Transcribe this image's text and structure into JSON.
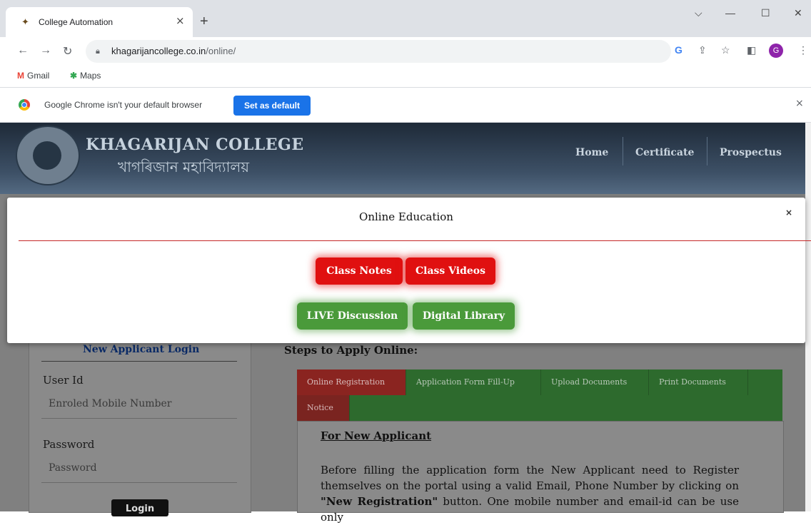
{
  "browser": {
    "tab_title": "College Automation",
    "tab_close": "×",
    "new_tab": "+",
    "window_controls": {
      "menu": "⌵",
      "minimize": "—",
      "maximize": "☐",
      "close": "✕"
    },
    "url_host": "khagarijancollege.co.in",
    "url_path": "/online/",
    "nav": {
      "back": "←",
      "forward": "→",
      "reload": "↻"
    },
    "toolbar_icons": {
      "google": "G",
      "share": "⇪",
      "star": "☆",
      "sidepanel": "◧"
    },
    "profile_initial": "G",
    "bookmarks": [
      {
        "icon": "M",
        "label": "Gmail"
      },
      {
        "icon": "✱",
        "label": "Maps"
      }
    ],
    "infobar": {
      "message": "Google Chrome isn't your default browser",
      "button": "Set as default",
      "close": "×"
    }
  },
  "site": {
    "title_en": "KHAGARIJAN COLLEGE",
    "title_bn": "খাগৰিজান মহাবিদ্যালয়",
    "nav": [
      "Home",
      "Certificate",
      "Prospectus"
    ]
  },
  "login_panel": {
    "title": "New Applicant Login",
    "userid_label": "User Id",
    "userid_placeholder": "Enroled Mobile Number",
    "password_label": "Password",
    "password_placeholder": "Password",
    "login_button": "Login"
  },
  "steps": {
    "title": "Steps to Apply Online:",
    "tabs": [
      "Online Registration",
      "Application Form Fill-Up",
      "Upload Documents",
      "Print Documents",
      "Notice"
    ],
    "active_tab": "Online Registration",
    "heading": "For New Applicant",
    "text_before": "Before filling the application form the New Applicant need to Register themselves on the portal using a valid Email, Phone Number by clicking on ",
    "text_bold": "\"New Registration\"",
    "text_after": " button. One mobile number and email-id can be use only"
  },
  "modal": {
    "title": "Online Education",
    "close": "×",
    "buttons": [
      "Class Notes",
      "Class Videos",
      "LIVE Discussion",
      "Digital Library"
    ]
  },
  "colors": {
    "red_button": "#e01010",
    "green_button": "#4a9a3a",
    "chrome_blue": "#1a73e8"
  }
}
